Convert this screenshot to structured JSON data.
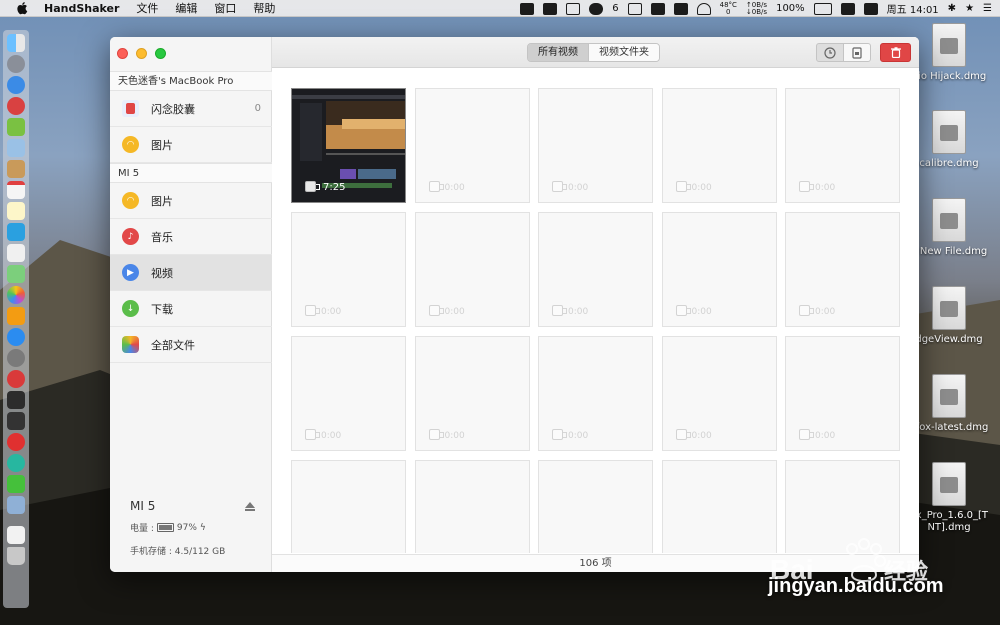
{
  "menubar": {
    "app_name": "HandShaker",
    "menus": [
      "文件",
      "编辑",
      "窗口",
      "帮助"
    ],
    "wechat_badge": "6",
    "temp": "48°C\n0",
    "net": "↑0B/s\n↓0B/s",
    "battery": "100%",
    "clock": "周五 14:01"
  },
  "desktop_files": [
    "dio Hijack.dmg",
    "calibre.dmg",
    "y New File.dmg",
    "dgeView.dmg",
    "efox-latest.dmg",
    "ox_Pro_1.6.0_[T\nNT].dmg"
  ],
  "sidebar": {
    "mac_section": "天色迷香's MacBook Pro",
    "mac_items": [
      {
        "label": "闪念胶囊",
        "count": "0"
      },
      {
        "label": "图片"
      }
    ],
    "phone_section": "MI 5",
    "phone_items": [
      {
        "label": "图片"
      },
      {
        "label": "音乐"
      },
      {
        "label": "视频"
      },
      {
        "label": "下载"
      },
      {
        "label": "全部文件"
      }
    ],
    "device": {
      "name": "MI 5",
      "battery_label": "电量 :",
      "battery_value": "97%",
      "battery_level": 0.97,
      "storage": "手机存储 : 4.5/112 GB"
    }
  },
  "toolbar": {
    "tabs": [
      "所有视频",
      "视频文件夹"
    ],
    "active_tab": 0
  },
  "grid": {
    "first_duration": "7:25",
    "placeholder_duration": "0:00"
  },
  "status": {
    "count_text": "106 项"
  },
  "watermark": {
    "text": "jingyan.baidu.com",
    "logo_text": "Bai du 经验"
  },
  "colors": {
    "accent": "#4a86e8",
    "delete": "#e04646"
  }
}
